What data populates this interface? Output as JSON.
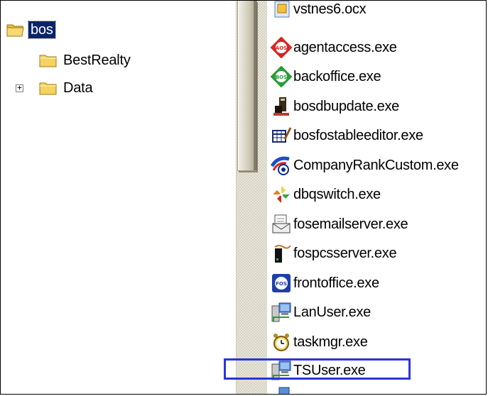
{
  "tree": {
    "root": {
      "label": "bos",
      "selected": true,
      "icon": "folder-open-icon"
    },
    "children": [
      {
        "label": "BestRealty",
        "icon": "folder-icon",
        "expander": ""
      },
      {
        "label": "Data",
        "icon": "folder-icon",
        "expander": "+"
      }
    ]
  },
  "files": [
    {
      "name": "vstnes6.ocx",
      "icon": "ocx-file-icon"
    },
    {
      "name": "agentaccess.exe",
      "icon": "aos-app-icon"
    },
    {
      "name": "backoffice.exe",
      "icon": "bos-app-icon"
    },
    {
      "name": "bosdbupdate.exe",
      "icon": "db-update-icon"
    },
    {
      "name": "bosfostableeditor.exe",
      "icon": "table-editor-icon"
    },
    {
      "name": "CompanyRankCustom.exe",
      "icon": "company-rank-icon"
    },
    {
      "name": "dbqswitch.exe",
      "icon": "pinwheel-icon"
    },
    {
      "name": "fosemailserver.exe",
      "icon": "email-server-icon"
    },
    {
      "name": "fospcsserver.exe",
      "icon": "server-icon"
    },
    {
      "name": "frontoffice.exe",
      "icon": "fos-app-icon"
    },
    {
      "name": "LanUser.exe",
      "icon": "network-computer-icon"
    },
    {
      "name": "taskmgr.exe",
      "icon": "alarm-clock-icon"
    },
    {
      "name": "TSUser.exe",
      "icon": "network-computer-icon",
      "highlighted": true
    }
  ],
  "colors": {
    "selection": "#0a246a",
    "highlight_border": "#2b35d9",
    "folder": "#f4d35e"
  }
}
